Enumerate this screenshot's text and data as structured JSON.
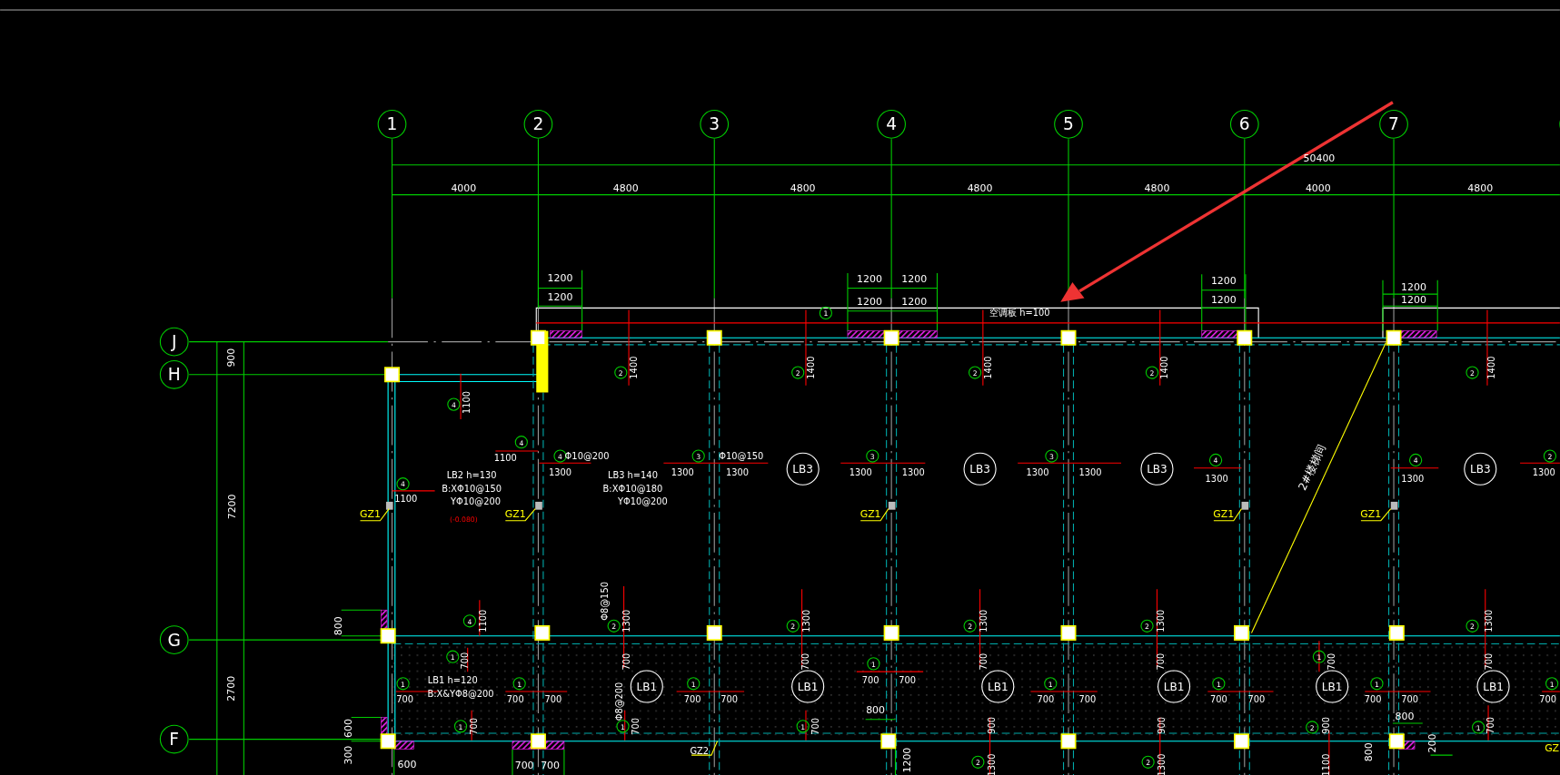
{
  "column_axes": [
    "1",
    "2",
    "3",
    "4",
    "5",
    "6",
    "7"
  ],
  "row_axes": [
    "J",
    "H",
    "G",
    "F"
  ],
  "overall_dimension": "50400",
  "bay_dimensions": [
    "4000",
    "4800",
    "4800",
    "4800",
    "4800",
    "4000",
    "4800"
  ],
  "left_dimensions": [
    "900",
    "7200",
    "800",
    "2700",
    "600",
    "300"
  ],
  "annotations": [
    {
      "text": "1200",
      "kind": "dim"
    },
    {
      "text": "1200",
      "kind": "dim"
    },
    {
      "text": "1200",
      "kind": "dim"
    },
    {
      "text": "1200",
      "kind": "dim"
    },
    {
      "text": "1200",
      "kind": "dim"
    },
    {
      "text": "1200",
      "kind": "dim"
    },
    {
      "text": "1200",
      "kind": "dim"
    },
    {
      "text": "1200",
      "kind": "dim"
    },
    {
      "text": "1200",
      "kind": "dim"
    },
    {
      "text": "1200",
      "kind": "dim"
    },
    {
      "text": "1",
      "kind": "mark"
    },
    {
      "text": "空调板 h=100",
      "kind": "note"
    },
    {
      "text": "2",
      "kind": "mark"
    },
    {
      "text": "1400",
      "kind": "note"
    },
    {
      "text": "2",
      "kind": "mark"
    },
    {
      "text": "1400",
      "kind": "note"
    },
    {
      "text": "2",
      "kind": "mark"
    },
    {
      "text": "1400",
      "kind": "note"
    },
    {
      "text": "2",
      "kind": "mark"
    },
    {
      "text": "1400",
      "kind": "note"
    },
    {
      "text": "2",
      "kind": "mark"
    },
    {
      "text": "1400",
      "kind": "note"
    },
    {
      "text": "4",
      "kind": "mark"
    },
    {
      "text": "1100",
      "kind": "note"
    },
    {
      "text": "4",
      "kind": "mark"
    },
    {
      "text": "1100",
      "kind": "note"
    },
    {
      "text": "4",
      "kind": "mark"
    },
    {
      "text": "1100",
      "kind": "note"
    },
    {
      "text": "LB2 h=130",
      "kind": "note"
    },
    {
      "text": "B:XΦ10@150",
      "kind": "note"
    },
    {
      "text": "YΦ10@200",
      "kind": "note"
    },
    {
      "text": "(-0.080)",
      "kind": "elevation"
    },
    {
      "text": "GZ1",
      "kind": "tag"
    },
    {
      "text": "GZ1",
      "kind": "tag"
    },
    {
      "text": "GZ1",
      "kind": "tag"
    },
    {
      "text": "GZ1",
      "kind": "tag"
    },
    {
      "text": "GZ1",
      "kind": "tag"
    },
    {
      "text": "4",
      "kind": "mark"
    },
    {
      "text": "Φ10@200",
      "kind": "note"
    },
    {
      "text": "1300",
      "kind": "note"
    },
    {
      "text": "LB3 h=140",
      "kind": "note"
    },
    {
      "text": "B:XΦ10@180",
      "kind": "note"
    },
    {
      "text": "YΦ10@200",
      "kind": "note"
    },
    {
      "text": "3",
      "kind": "mark"
    },
    {
      "text": "Φ10@150",
      "kind": "note"
    },
    {
      "text": "1300",
      "kind": "note"
    },
    {
      "text": "1300",
      "kind": "note"
    },
    {
      "text": "LB3",
      "kind": "slab"
    },
    {
      "text": "3",
      "kind": "mark"
    },
    {
      "text": "1300",
      "kind": "note"
    },
    {
      "text": "1300",
      "kind": "note"
    },
    {
      "text": "LB3",
      "kind": "slab"
    },
    {
      "text": "3",
      "kind": "mark"
    },
    {
      "text": "1300",
      "kind": "note"
    },
    {
      "text": "1300",
      "kind": "note"
    },
    {
      "text": "LB3",
      "kind": "slab"
    },
    {
      "text": "4",
      "kind": "mark"
    },
    {
      "text": "1300",
      "kind": "note"
    },
    {
      "text": "2#楼梯间",
      "kind": "stair"
    },
    {
      "text": "4",
      "kind": "mark"
    },
    {
      "text": "1300",
      "kind": "note"
    },
    {
      "text": "LB3",
      "kind": "slab"
    },
    {
      "text": "2",
      "kind": "mark"
    },
    {
      "text": "1300",
      "kind": "note"
    },
    {
      "text": "4",
      "kind": "mark"
    },
    {
      "text": "1100",
      "kind": "note"
    },
    {
      "text": "Φ8@150",
      "kind": "note"
    },
    {
      "text": "2",
      "kind": "mark"
    },
    {
      "text": "1300",
      "kind": "note"
    },
    {
      "text": "2",
      "kind": "mark"
    },
    {
      "text": "1300",
      "kind": "note"
    },
    {
      "text": "2",
      "kind": "mark"
    },
    {
      "text": "1300",
      "kind": "note"
    },
    {
      "text": "2",
      "kind": "mark"
    },
    {
      "text": "1300",
      "kind": "note"
    },
    {
      "text": "2",
      "kind": "mark"
    },
    {
      "text": "1300",
      "kind": "note"
    },
    {
      "text": "700",
      "kind": "note"
    },
    {
      "text": "700",
      "kind": "note"
    },
    {
      "text": "700",
      "kind": "note"
    },
    {
      "text": "700",
      "kind": "note"
    },
    {
      "text": "700",
      "kind": "note"
    },
    {
      "text": "1",
      "kind": "mark"
    },
    {
      "text": "700",
      "kind": "note"
    },
    {
      "text": "LB1 h=120",
      "kind": "note"
    },
    {
      "text": "B:X&YΦ8@200",
      "kind": "note"
    },
    {
      "text": "1",
      "kind": "mark"
    },
    {
      "text": "700",
      "kind": "note"
    },
    {
      "text": "1",
      "kind": "mark"
    },
    {
      "text": "700",
      "kind": "note"
    },
    {
      "text": "700",
      "kind": "note"
    },
    {
      "text": "LB1",
      "kind": "slab"
    },
    {
      "text": "1",
      "kind": "mark"
    },
    {
      "text": "700",
      "kind": "note"
    },
    {
      "text": "700",
      "kind": "note"
    },
    {
      "text": "LB1",
      "kind": "slab"
    },
    {
      "text": "1",
      "kind": "mark"
    },
    {
      "text": "700",
      "kind": "note"
    },
    {
      "text": "700",
      "kind": "note"
    },
    {
      "text": "LB1",
      "kind": "slab"
    },
    {
      "text": "1",
      "kind": "mark"
    },
    {
      "text": "700",
      "kind": "note"
    },
    {
      "text": "700",
      "kind": "note"
    },
    {
      "text": "LB1",
      "kind": "slab"
    },
    {
      "text": "1",
      "kind": "mark"
    },
    {
      "text": "700",
      "kind": "note"
    },
    {
      "text": "700",
      "kind": "note"
    },
    {
      "text": "1",
      "kind": "mark"
    },
    {
      "text": "700",
      "kind": "note"
    },
    {
      "text": "LB1",
      "kind": "slab"
    },
    {
      "text": "1",
      "kind": "mark"
    },
    {
      "text": "700",
      "kind": "note"
    },
    {
      "text": "700",
      "kind": "note"
    },
    {
      "text": "LB1",
      "kind": "slab"
    },
    {
      "text": "1",
      "kind": "mark"
    },
    {
      "text": "700",
      "kind": "note"
    },
    {
      "text": "1",
      "kind": "mark"
    },
    {
      "text": "700",
      "kind": "note"
    },
    {
      "text": "Φ8@200",
      "kind": "note"
    },
    {
      "text": "1",
      "kind": "mark"
    },
    {
      "text": "700",
      "kind": "note"
    },
    {
      "text": "1",
      "kind": "mark"
    },
    {
      "text": "700",
      "kind": "note"
    },
    {
      "text": "800",
      "kind": "dim"
    },
    {
      "text": "900",
      "kind": "note"
    },
    {
      "text": "900",
      "kind": "note"
    },
    {
      "text": "2",
      "kind": "mark"
    },
    {
      "text": "900",
      "kind": "note"
    },
    {
      "text": "800",
      "kind": "dim"
    },
    {
      "text": "1",
      "kind": "mark"
    },
    {
      "text": "700",
      "kind": "note"
    },
    {
      "text": "600",
      "kind": "dim"
    },
    {
      "text": "700",
      "kind": "dim"
    },
    {
      "text": "700",
      "kind": "dim"
    },
    {
      "text": "GZ2",
      "kind": "note"
    },
    {
      "text": "1200",
      "kind": "dim"
    },
    {
      "text": "2",
      "kind": "mark"
    },
    {
      "text": "1300",
      "kind": "note"
    },
    {
      "text": "2",
      "kind": "mark"
    },
    {
      "text": "1300",
      "kind": "note"
    },
    {
      "text": "1100",
      "kind": "note"
    },
    {
      "text": "800",
      "kind": "dim"
    },
    {
      "text": "200",
      "kind": "dim"
    },
    {
      "text": "GZ",
      "kind": "tag"
    }
  ]
}
